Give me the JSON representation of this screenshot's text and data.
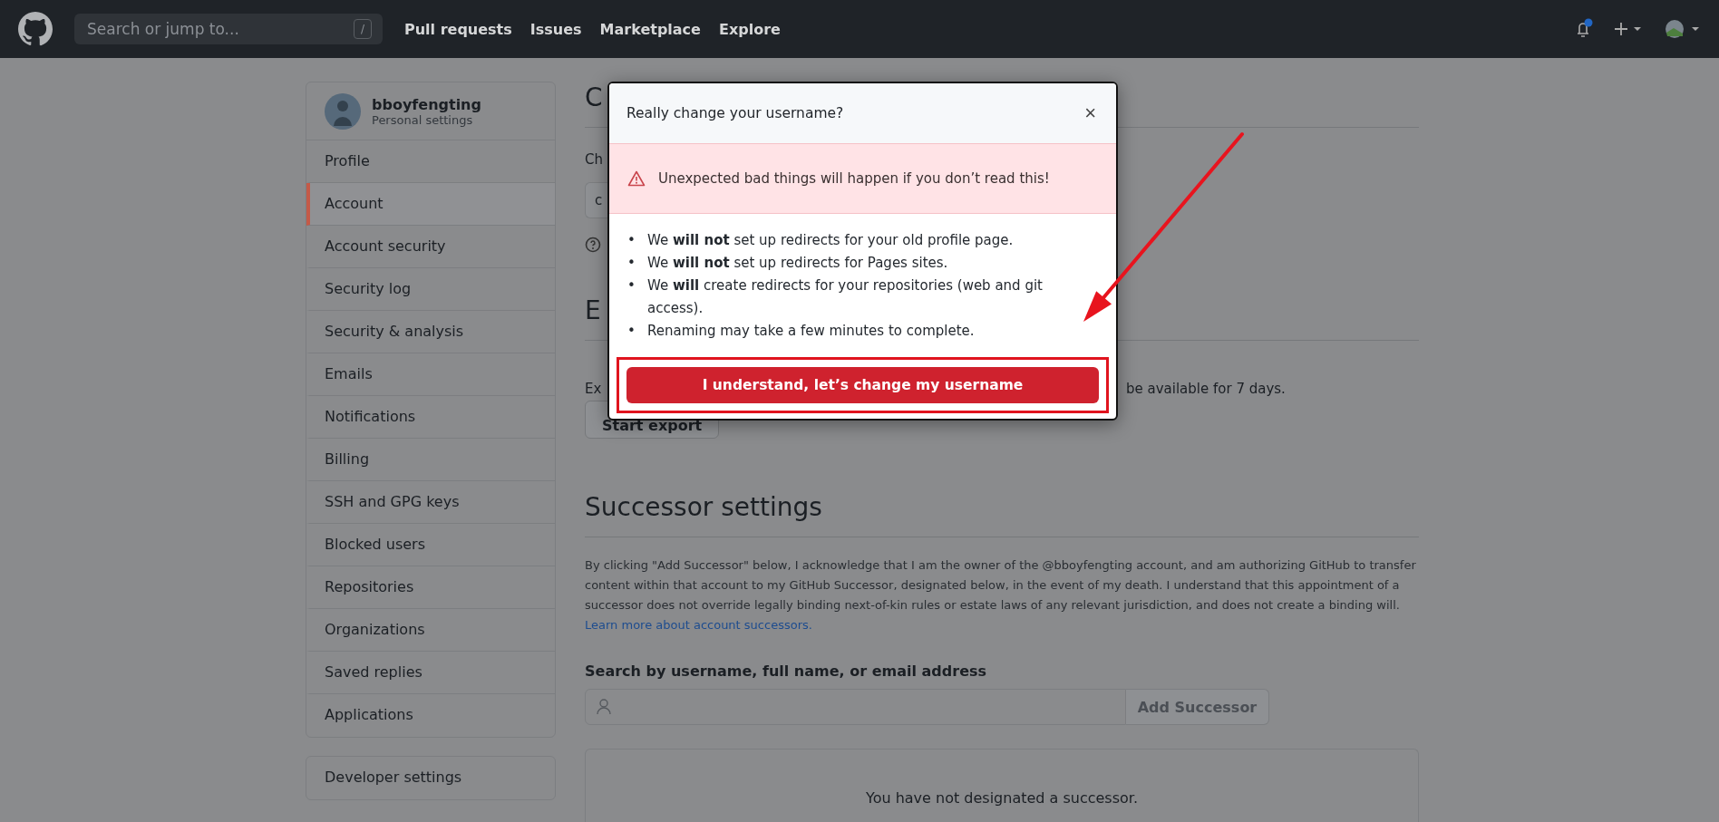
{
  "header": {
    "search": {
      "placeholder": "Search or jump to...",
      "shortcut": "/"
    },
    "nav": [
      "Pull requests",
      "Issues",
      "Marketplace",
      "Explore"
    ],
    "notification_unread": true
  },
  "sidebar": {
    "username": "bboyfengting",
    "subtitle": "Personal settings",
    "items": [
      {
        "label": "Profile",
        "selected": false
      },
      {
        "label": "Account",
        "selected": true
      },
      {
        "label": "Account security",
        "selected": false
      },
      {
        "label": "Security log",
        "selected": false
      },
      {
        "label": "Security & analysis",
        "selected": false
      },
      {
        "label": "Emails",
        "selected": false
      },
      {
        "label": "Notifications",
        "selected": false
      },
      {
        "label": "Billing",
        "selected": false
      },
      {
        "label": "SSH and GPG keys",
        "selected": false
      },
      {
        "label": "Blocked users",
        "selected": false
      },
      {
        "label": "Repositories",
        "selected": false
      },
      {
        "label": "Organizations",
        "selected": false
      },
      {
        "label": "Saved replies",
        "selected": false
      },
      {
        "label": "Applications",
        "selected": false
      }
    ],
    "developer_settings": "Developer settings"
  },
  "main": {
    "heading_1": "C",
    "label_1": "Ch",
    "field_1": "c",
    "heading_2": "E",
    "export_left": "Ex",
    "export_right": "be available for 7 days.",
    "export_button": "Start export",
    "successor": {
      "heading": "Successor settings",
      "paragraph": "By clicking \"Add Successor\" below, I acknowledge that I am the owner of the @bboyfengting account, and am authorizing GitHub to transfer content within that account to my GitHub Successor, designated below, in the event of my death. I understand that this appointment of a successor does not override legally binding next-of-kin rules or estate laws of any relevant jurisdiction, and does not create a binding will.",
      "link": "Learn more about account successors.",
      "search_label": "Search by username, full name, or email address",
      "add_button": "Add Successor",
      "empty": "You have not designated a successor."
    }
  },
  "modal": {
    "title": "Really change your username?",
    "close": "×",
    "marker": "•",
    "warning": "Unexpected bad things will happen if you don’t read this!",
    "points": [
      "We **will not** set up redirects for your old profile page.",
      "We **will not** set up redirects for Pages sites.",
      "We **will** create redirects for your repositories (web and git access).",
      "Renaming may take a few minutes to complete."
    ],
    "confirm": "I understand, let’s change my username"
  }
}
